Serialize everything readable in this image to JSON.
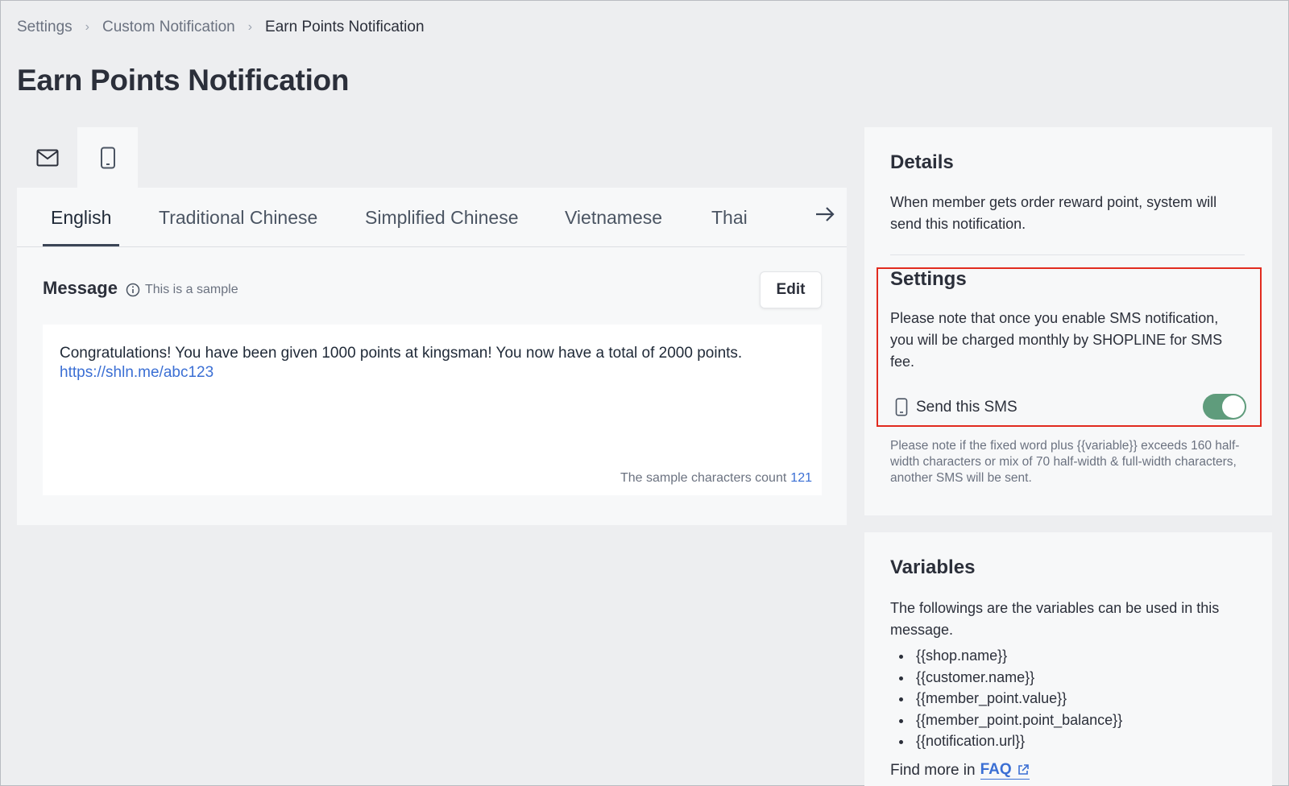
{
  "breadcrumb": {
    "items": [
      "Settings",
      "Custom Notification",
      "Earn Points Notification"
    ]
  },
  "page": {
    "title": "Earn Points Notification"
  },
  "channels": {
    "items": [
      {
        "icon": "mail-icon"
      },
      {
        "icon": "mobile-phone-icon",
        "active": true
      }
    ]
  },
  "languages": {
    "tabs": [
      "English",
      "Traditional Chinese",
      "Simplified Chinese",
      "Vietnamese",
      "Thai"
    ],
    "active": "English",
    "next_icon": "arrow-right-icon"
  },
  "message": {
    "label": "Message",
    "hint": "This is a sample",
    "edit_label": "Edit",
    "body": "Congratulations! You have been given 1000 points at kingsman! You now have a total of 2000 points.",
    "link": "https://shln.me/abc123",
    "count_label": "The sample characters count",
    "count_value": "121"
  },
  "details": {
    "title": "Details",
    "text": "When member gets order reward point, system will send this notification."
  },
  "settings": {
    "title": "Settings",
    "text": "Please note that once you enable SMS notification, you will be charged monthly by SHOPLINE for SMS fee.",
    "sms_label": "Send this SMS",
    "sms_enabled": true,
    "toggle_color": "#5f9c7c",
    "note": "Please note if the fixed word plus {{variable}} exceeds 160 half-width characters or mix of 70 half-width & full-width characters, another SMS will be sent."
  },
  "variables": {
    "title": "Variables",
    "text": "The followings are the variables can be used in this message.",
    "items": [
      "{{shop.name}}",
      "{{customer.name}}",
      "{{member_point.value}}",
      "{{member_point.point_balance}}",
      "{{notification.url}}"
    ],
    "faq_prefix": "Find more in",
    "faq_label": "FAQ"
  },
  "colors": {
    "accent": "#3b6fd4",
    "highlight_border": "#e12b1f"
  }
}
